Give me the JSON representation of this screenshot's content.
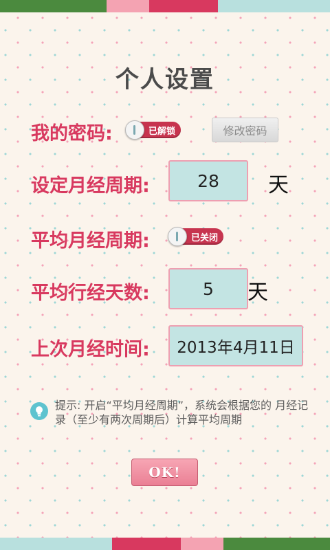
{
  "colors": {
    "stripe_top": [
      "#4b8a3e",
      "#f4a3b2",
      "#d8395f",
      "#b8e0de"
    ],
    "stripe_bottom": [
      "#b8e0de",
      "#d8395f",
      "#f4a3b2",
      "#4b8a3e"
    ],
    "label": "#d8395f",
    "field_bg": "#c3e4e3"
  },
  "title": "个人设置",
  "password": {
    "label": "我的密码:",
    "toggle_text": "已解锁",
    "change_button": "修改密码"
  },
  "cycle": {
    "label": "设定月经周期:",
    "value": "28",
    "unit": "天"
  },
  "avg_cycle": {
    "label": "平均月经周期:",
    "toggle_text": "已关闭"
  },
  "period_days": {
    "label": "平均行经天数:",
    "value": "5",
    "unit": "天"
  },
  "last_period": {
    "label": "上次月经时间:",
    "value": "2013年4月11日"
  },
  "tip": {
    "icon": "lightbulb-icon",
    "text": "提示: 开启“平均月经周期”，系统会根据您的 月经记录（至少有两次周期后）计算平均周期"
  },
  "ok_button": "OK!"
}
